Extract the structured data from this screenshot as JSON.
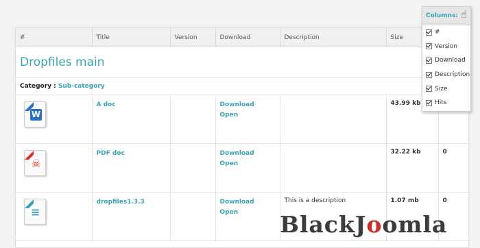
{
  "columns_header": [
    "#",
    "Title",
    "Version",
    "Download",
    "Description",
    "Size",
    ""
  ],
  "category_title": "Dropfiles main",
  "category_label": "Category",
  "category_separator": " : ",
  "category_name": "Sub-category",
  "files": [
    {
      "icon": "word-doc-icon",
      "icon_color": "#2b6fc2",
      "glyph": "W",
      "title": "A doc",
      "version": "",
      "download_label": "Download",
      "open_label": "Open",
      "description": "",
      "size": "43.99 kb",
      "hits": ""
    },
    {
      "icon": "pdf-icon",
      "icon_color": "#d8302b",
      "glyph": "☠",
      "title": "PDF doc",
      "version": "",
      "download_label": "Download",
      "open_label": "Open",
      "description": "",
      "size": "32.22 kb",
      "hits": "0"
    },
    {
      "icon": "zip-archive-icon",
      "icon_color": "#39a0b3",
      "glyph": "≡",
      "title": "dropfiles1.3.3",
      "version": "",
      "download_label": "Download",
      "open_label": "Open",
      "description": "This is a description",
      "size": "1.07 mb",
      "hits": "0"
    }
  ],
  "columns_panel": {
    "title": "Columns:",
    "items": [
      "#",
      "Version",
      "Download",
      "Description",
      "Size",
      "Hits"
    ]
  },
  "watermark": {
    "part1": "BlackJ",
    "part2": "o",
    "part3": "omla"
  }
}
